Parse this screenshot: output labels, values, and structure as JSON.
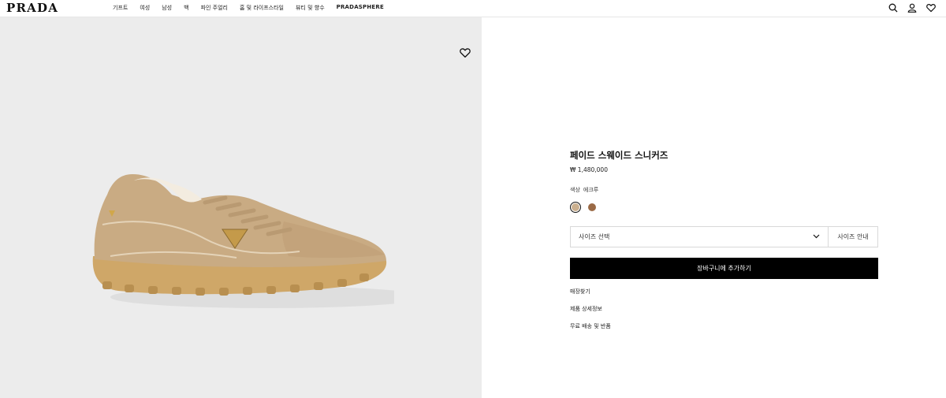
{
  "header": {
    "logo": "PRADA",
    "nav": [
      "기프트",
      "여성",
      "남성",
      "백",
      "파인 주얼리",
      "홈 및 라이프스타일",
      "뷰티 및 향수",
      "PRADASPHERE"
    ]
  },
  "icons": {
    "search": "search-icon",
    "account": "user-icon",
    "wishlist": "heart-icon"
  },
  "product": {
    "title": "페이드 스웨이드 스니커즈",
    "price": "₩ 1,480,000",
    "color_label": "색상",
    "color_value": "에크루",
    "swatches": [
      {
        "color": "#cbb08f",
        "selected": true
      },
      {
        "color": "#9a6a46",
        "selected": false
      }
    ],
    "size_select_label": "사이즈 선택",
    "size_guide_label": "사이즈 안내",
    "cart_button": "장바구니에 추가하기",
    "links": [
      "매장찾기",
      "제품 상세정보",
      "무료 배송 및 반품"
    ]
  },
  "colors": {
    "image_background": "#ececec",
    "cart_button_bg": "#000000"
  }
}
